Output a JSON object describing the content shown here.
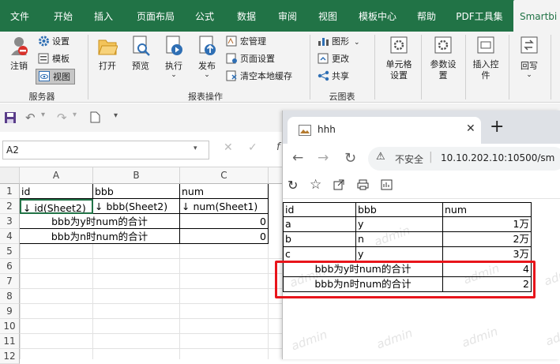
{
  "ribbon_tabs": [
    "文件",
    "开始",
    "插入",
    "页面布局",
    "公式",
    "数据",
    "审阅",
    "视图",
    "模板中心",
    "帮助",
    "PDF工具集",
    "Smartbi"
  ],
  "ribbon_groups": {
    "server": {
      "label": "服务器",
      "logout": "注销",
      "settings": "设置",
      "template": "模板",
      "view": "视图"
    },
    "report": {
      "label": "报表操作",
      "open": "打开",
      "preview": "预览",
      "execute": "执行",
      "publish": "发布",
      "macro": "宏管理",
      "page_setup": "页面设置",
      "clear_cache": "清空本地缓存"
    },
    "cloud": {
      "label": "云图表",
      "chart": "图形",
      "update": "更改",
      "share": "共享"
    },
    "cell_setting": "单元格\n设置",
    "param_setting": "参数设\n置",
    "insert_ctrl": "插入控\n件",
    "writeback": "回写"
  },
  "qat": {
    "arrow": "▾"
  },
  "formula_bar": {
    "cell_ref": "A2",
    "fx": "f"
  },
  "excel": {
    "columns": [
      "A",
      "B",
      "C"
    ],
    "rows": [
      "1",
      "2",
      "3",
      "4",
      "5",
      "6",
      "7",
      "8",
      "9",
      "10",
      "11",
      "12"
    ],
    "row1": [
      "id",
      "bbb",
      "num"
    ],
    "row2": [
      "↓ id(Sheet2)",
      "↓ bbb(Sheet2)",
      "↓ num(Sheet1)"
    ],
    "row3": {
      "label": "bbb为y时num的合计",
      "value": "0"
    },
    "row4": {
      "label": "bbb为n时num的合计",
      "value": "0"
    }
  },
  "browser": {
    "tab_title": "hhh",
    "new_tab": "+",
    "security_label": "不安全",
    "url": "10.10.202.10:10500/sm",
    "report": {
      "header": [
        "id",
        "bbb",
        "num"
      ],
      "rows": [
        [
          "a",
          "y",
          "1万"
        ],
        [
          "b",
          "n",
          "2万"
        ],
        [
          "c",
          "y",
          "3万"
        ]
      ],
      "sum_y": {
        "label": "bbb为y时num的合计",
        "value": "4"
      },
      "sum_n": {
        "label": "bbb为n时num的合计",
        "value": "2"
      }
    },
    "watermark": "admin"
  },
  "colors": {
    "excel_green": "#217346",
    "highlight_red": "#e8151b"
  }
}
